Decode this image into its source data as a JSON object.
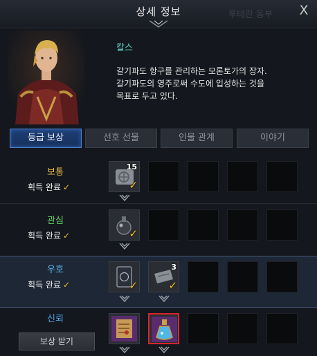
{
  "header": {
    "title": "상세 정보",
    "background_title": "루테란 동부",
    "close_glyph": "X"
  },
  "character": {
    "name": "칼스",
    "description": "갈기파도 항구를 관리하는 모론토가의 장자.\n갈기파도의 영주로써 수도에 입성하는 것을\n목표로 두고 있다."
  },
  "tabs": [
    {
      "label": "등급 보상",
      "active": true
    },
    {
      "label": "선호 선물",
      "active": false
    },
    {
      "label": "인물 관계",
      "active": false
    },
    {
      "label": "이야기",
      "active": false
    }
  ],
  "tiers": [
    {
      "name": "보통",
      "color": "#e6b84a",
      "status": "획득 완료",
      "check": "✓",
      "rewards": [
        {
          "icon": "scroll-icon",
          "quantity": "15",
          "claimed": true
        }
      ]
    },
    {
      "name": "관심",
      "color": "#5fd36a",
      "status": "획득 완료",
      "check": "✓",
      "rewards": [
        {
          "icon": "flask-bomb-icon",
          "claimed": true
        }
      ]
    },
    {
      "name": "우호",
      "color": "#5cb8f0",
      "status": "획득 완료",
      "check": "✓",
      "rewards": [
        {
          "icon": "card-icon",
          "claimed": true
        },
        {
          "icon": "scroll-icon",
          "quantity": "3",
          "claimed": true
        }
      ]
    },
    {
      "name": "신뢰",
      "color": "#4aa3ea",
      "button": "보상 받기",
      "rewards": [
        {
          "icon": "map-scroll-icon",
          "claimed": false
        },
        {
          "icon": "potion-icon",
          "claimed": false,
          "selected": true
        }
      ]
    }
  ],
  "colors": {
    "accent": "#4f7fc8",
    "check": "#f4c21d",
    "selected_border": "#d8262b"
  }
}
